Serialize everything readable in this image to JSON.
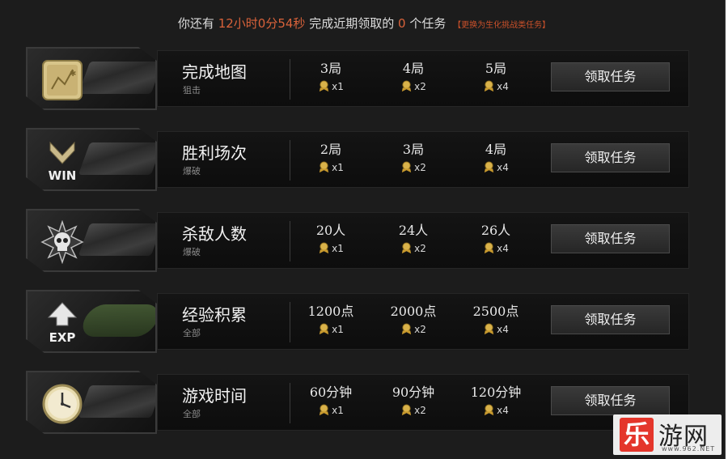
{
  "header": {
    "prefix": "你还有",
    "time_left": "12小时0分54秒",
    "middle": "完成近期领取的",
    "count": "0",
    "suffix": "个任务",
    "switch_link": "【更换为生化挑战类任务】"
  },
  "accent_color": "#d9623a",
  "tasks": [
    {
      "title": "完成地图",
      "mode": "狙击",
      "icon": "map-icon",
      "tiers": [
        {
          "req": "3局",
          "reward": "x1"
        },
        {
          "req": "4局",
          "reward": "x2"
        },
        {
          "req": "5局",
          "reward": "x4"
        }
      ],
      "button": "领取任务"
    },
    {
      "title": "胜利场次",
      "mode": "爆破",
      "icon": "win-icon",
      "icon_text": "WIN",
      "tiers": [
        {
          "req": "2局",
          "reward": "x1"
        },
        {
          "req": "3局",
          "reward": "x2"
        },
        {
          "req": "4局",
          "reward": "x4"
        }
      ],
      "button": "领取任务"
    },
    {
      "title": "杀敌人数",
      "mode": "爆破",
      "icon": "skull-icon",
      "tiers": [
        {
          "req": "20人",
          "reward": "x1"
        },
        {
          "req": "24人",
          "reward": "x2"
        },
        {
          "req": "26人",
          "reward": "x4"
        }
      ],
      "button": "领取任务"
    },
    {
      "title": "经验积累",
      "mode": "全部",
      "icon": "exp-icon",
      "icon_text": "EXP",
      "tiers": [
        {
          "req": "1200点",
          "reward": "x1"
        },
        {
          "req": "2000点",
          "reward": "x2"
        },
        {
          "req": "2500点",
          "reward": "x4"
        }
      ],
      "button": "领取任务"
    },
    {
      "title": "游戏时间",
      "mode": "全部",
      "icon": "clock-icon",
      "tiers": [
        {
          "req": "60分钟",
          "reward": "x1"
        },
        {
          "req": "90分钟",
          "reward": "x2"
        },
        {
          "req": "120分钟",
          "reward": "x4"
        }
      ],
      "button": "领取任务"
    }
  ],
  "watermark": {
    "mark": "乐",
    "name": "游网",
    "url": "www.962.NET"
  }
}
